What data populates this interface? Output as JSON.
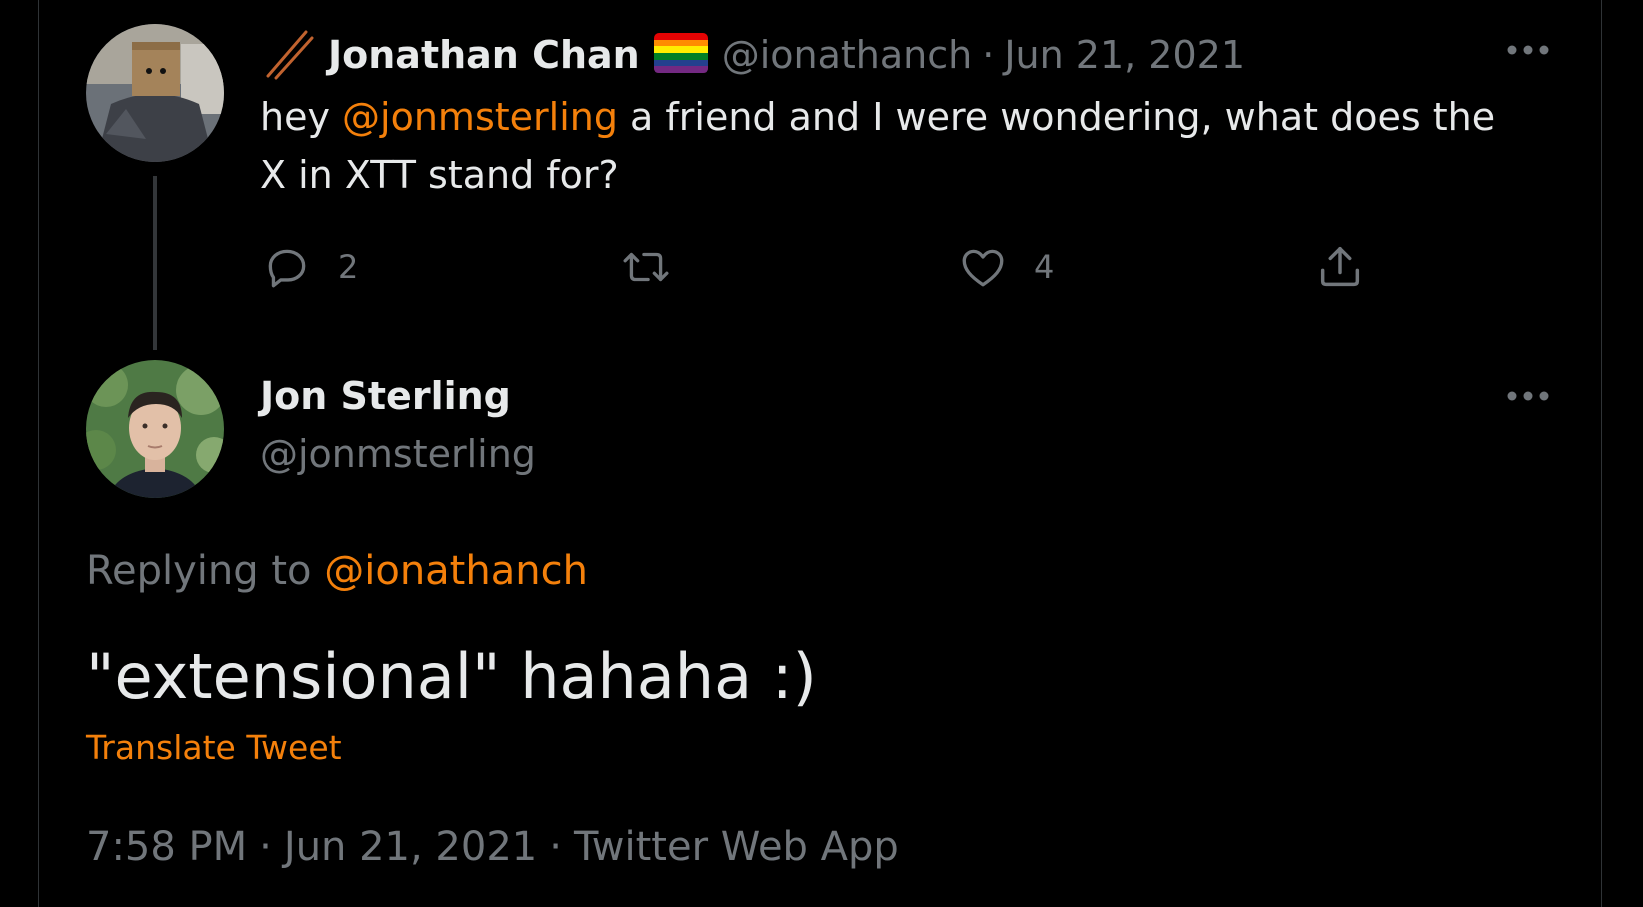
{
  "parent_tweet": {
    "display_name": "Jonathan Chan",
    "handle": "@ionathanch",
    "separator": "·",
    "date": "Jun 21, 2021",
    "text_before": "hey ",
    "mention": "@jonmsterling",
    "text_after_line1": " a friend and I were wondering, what does the",
    "text_line2": "X in XTT stand for?",
    "reply_count": "2",
    "like_count": "4",
    "name_icon": "chopsticks-icon",
    "flag_icon": "rainbow-flag-icon"
  },
  "main_tweet": {
    "display_name": "Jon Sterling",
    "handle": "@jonmsterling",
    "replying_prefix": "Replying to ",
    "replying_mention": "@ionathanch",
    "text": "\"extensional\" hahaha :)",
    "translate_label": "Translate Tweet",
    "time": "7:58 PM",
    "separator": "·",
    "date": "Jun 21, 2021",
    "source": "Twitter Web App"
  },
  "colors": {
    "background": "#000000",
    "text_primary": "#e7e9ea",
    "text_secondary": "#71767b",
    "accent": "#f4800b",
    "border": "#2f3336"
  }
}
